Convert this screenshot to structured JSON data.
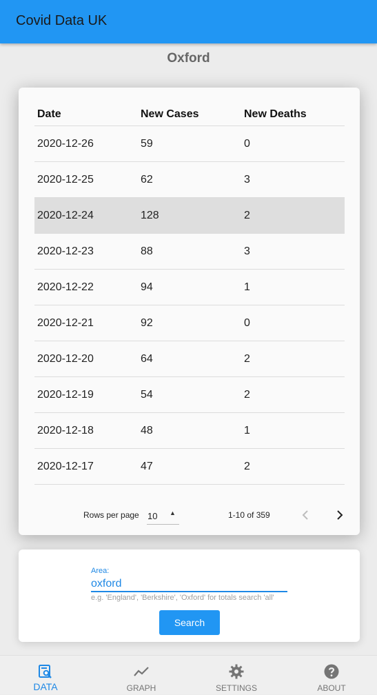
{
  "app": {
    "title": "Covid Data UK",
    "accent": "#2196f3"
  },
  "page": {
    "title": "Oxford"
  },
  "table": {
    "columns": [
      "Date",
      "New Cases",
      "New Deaths"
    ],
    "rows": [
      [
        "2020-12-26",
        "59",
        "0"
      ],
      [
        "2020-12-25",
        "62",
        "3"
      ],
      [
        "2020-12-24",
        "128",
        "2"
      ],
      [
        "2020-12-23",
        "88",
        "3"
      ],
      [
        "2020-12-22",
        "94",
        "1"
      ],
      [
        "2020-12-21",
        "92",
        "0"
      ],
      [
        "2020-12-20",
        "64",
        "2"
      ],
      [
        "2020-12-19",
        "54",
        "2"
      ],
      [
        "2020-12-18",
        "48",
        "1"
      ],
      [
        "2020-12-17",
        "47",
        "2"
      ]
    ],
    "selected_row": 2
  },
  "pager": {
    "rows_per_page_label": "Rows per page",
    "rows_per_page_value": "10",
    "range": "1-10 of 359",
    "prev_icon": "chevron-left-icon",
    "next_icon": "chevron-right-icon"
  },
  "search": {
    "label": "Area:",
    "value": "oxford",
    "hint": "e.g. 'England', 'Berkshire', 'Oxford' for totals search 'all'",
    "button_label": "Search"
  },
  "nav": {
    "items": [
      {
        "label": "DATA",
        "icon": "data-search-icon",
        "active": true
      },
      {
        "label": "GRAPH",
        "icon": "graph-icon",
        "active": false
      },
      {
        "label": "SETTINGS",
        "icon": "gear-icon",
        "active": false
      },
      {
        "label": "ABOUT",
        "icon": "help-icon",
        "active": false
      }
    ]
  }
}
